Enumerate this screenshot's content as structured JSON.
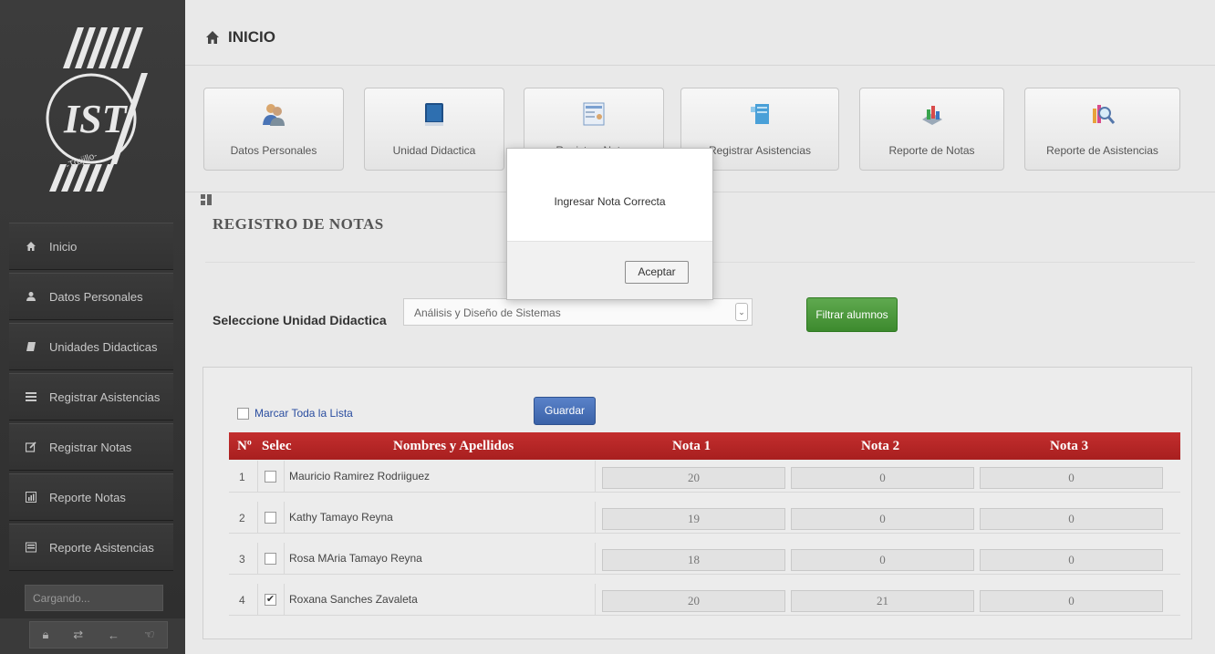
{
  "sidebar": {
    "items": [
      {
        "label": "Inicio",
        "icon": "home-icon"
      },
      {
        "label": "Datos Personales",
        "icon": "user-icon"
      },
      {
        "label": "Unidades Didacticas",
        "icon": "book-icon"
      },
      {
        "label": "Registrar Asistencias",
        "icon": "list-icon"
      },
      {
        "label": "Registrar Notas",
        "icon": "edit-icon"
      },
      {
        "label": "Reporte Notas",
        "icon": "chart-icon"
      },
      {
        "label": "Reporte Asistencias",
        "icon": "report-icon"
      }
    ],
    "loading_text": "Cargando...",
    "tools": [
      "lock-icon",
      "exchange-icon",
      "back-icon",
      "hand-icon"
    ]
  },
  "header": {
    "title": "INICIO"
  },
  "quick_buttons": [
    {
      "label": "Datos Personales",
      "icon": "people-icon"
    },
    {
      "label": "Unidad Didactica",
      "icon": "book-icon"
    },
    {
      "label": "Registrar Notas",
      "icon": "form-icon"
    },
    {
      "label": "Registrar Asistencias",
      "icon": "note-icon"
    },
    {
      "label": "Reporte de Notas",
      "icon": "graph-icon"
    },
    {
      "label": "Reporte de Asistencias",
      "icon": "magnifier-icon"
    }
  ],
  "section": {
    "title": "REGISTRO DE NOTAS"
  },
  "filter": {
    "label": "Seleccione Unidad Didactica",
    "selected": "Análisis y Diseño de Sistemas",
    "button": "Filtrar alumnos"
  },
  "list": {
    "mark_all_label": "Marcar Toda la Lista",
    "save_label": "Guardar",
    "columns": [
      "Nº",
      "Selec",
      "Nombres y Apellidos",
      "Nota 1",
      "Nota 2",
      "Nota 3"
    ],
    "rows": [
      {
        "num": "1",
        "checked": false,
        "name": "Mauricio Ramirez Rodriiguez",
        "n1": "20",
        "n2": "0",
        "n3": "0"
      },
      {
        "num": "2",
        "checked": false,
        "name": "Kathy Tamayo Reyna",
        "n1": "19",
        "n2": "0",
        "n3": "0"
      },
      {
        "num": "3",
        "checked": false,
        "name": "Rosa MAria Tamayo Reyna",
        "n1": "18",
        "n2": "0",
        "n3": "0"
      },
      {
        "num": "4",
        "checked": true,
        "name": "Roxana Sanches Zavaleta",
        "n1": "20",
        "n2": "21",
        "n3": "0"
      }
    ]
  },
  "modal": {
    "message": "Ingresar Nota Correcta",
    "ok_label": "Aceptar"
  },
  "colors": {
    "header_red": "#b52424",
    "save_blue": "#3a62a8",
    "filter_green": "#4a9a3a",
    "sidebar_bg": "#333333"
  }
}
